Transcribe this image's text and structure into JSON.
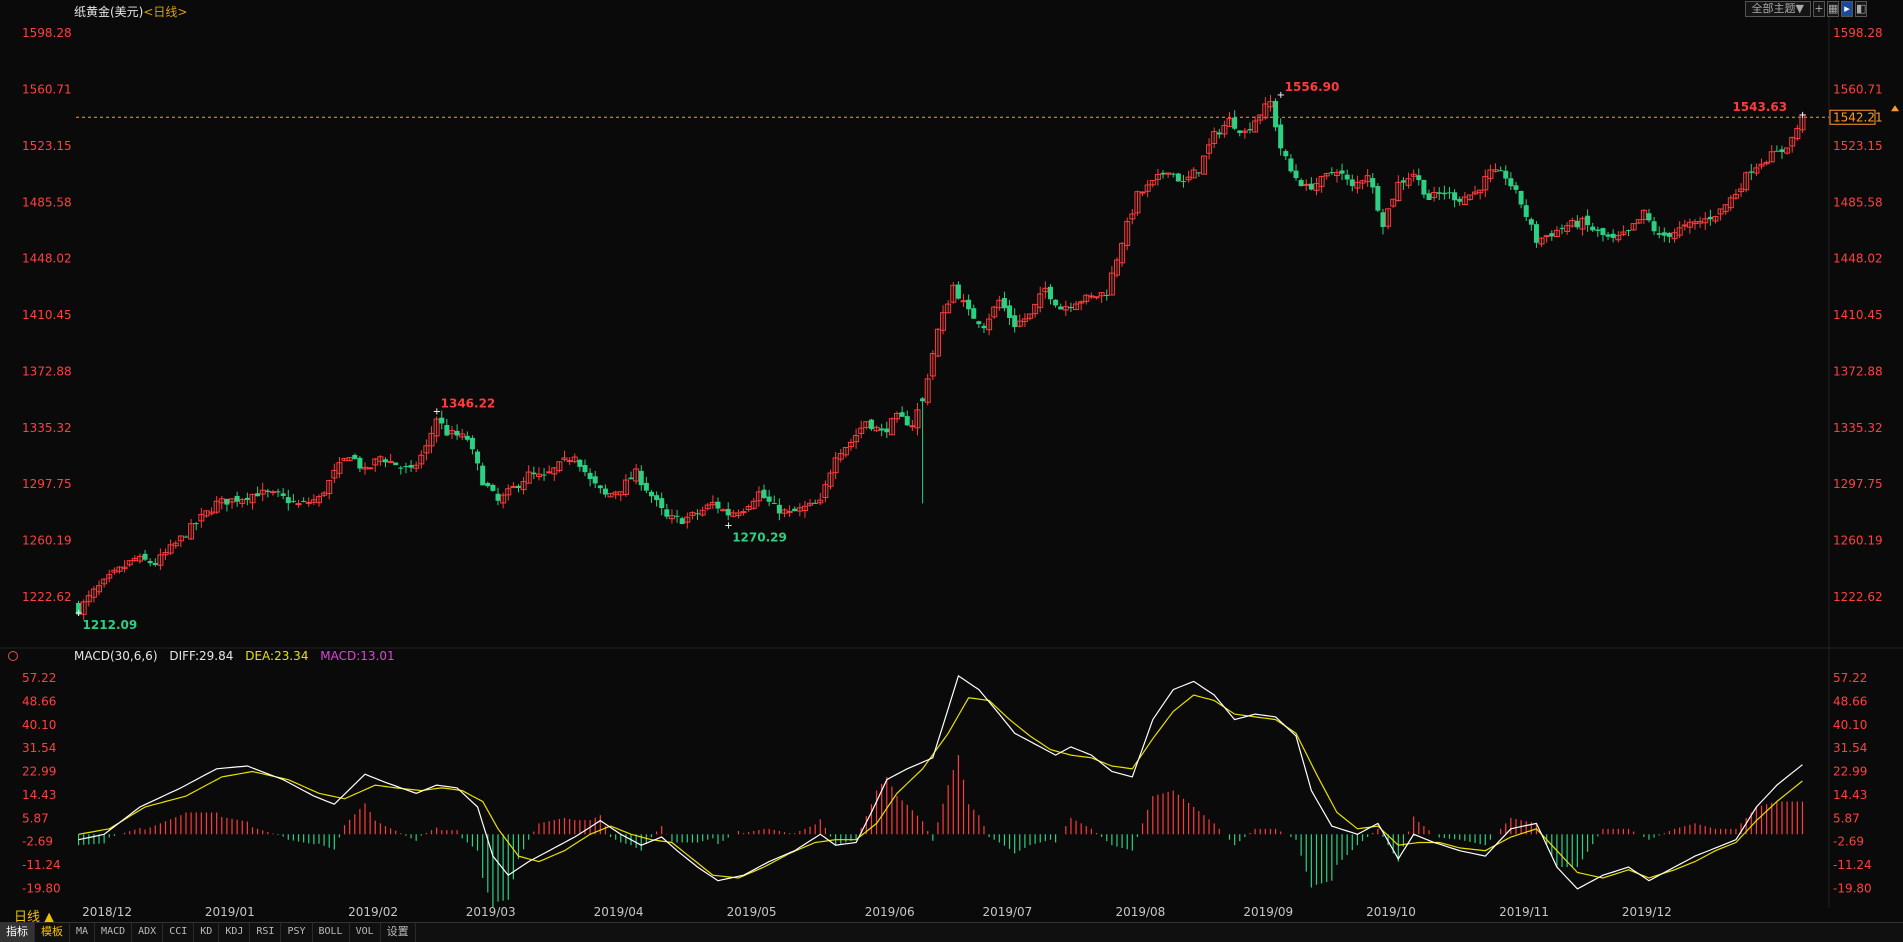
{
  "header": {
    "instrument": "纸黄金(美元)",
    "period": "<日线>",
    "theme_button": "全部主题▼"
  },
  "macd_header": {
    "name": "MACD(30,6,6)",
    "diff": "DIFF:29.84",
    "dea": "DEA:23.34",
    "macd": "MACD:13.01"
  },
  "period_label": "日线 ▲",
  "tabs": [
    "指标",
    "模板",
    "MA",
    "MACD",
    "ADX",
    "CCI",
    "KD",
    "KDJ",
    "RSI",
    "PSY",
    "BOLL",
    "VOL",
    "设置"
  ],
  "colors": {
    "up": "#ff3b3b",
    "down": "#2bd083",
    "diff_line": "#ffffff",
    "dea_line": "#e8e000",
    "axis_text": "#ff4040",
    "date_text": "#c8c8c8",
    "last_price": "#ff9a2a"
  },
  "chart_data": [
    {
      "type": "candlestick",
      "title": "纸黄金(美元)",
      "ylim": [
        1194,
        1607
      ],
      "y_ticks": [
        1598.28,
        1560.71,
        1523.15,
        1485.58,
        1448.02,
        1410.45,
        1372.88,
        1335.32,
        1297.75,
        1260.19,
        1222.62
      ],
      "x_ticks": [
        "2018/12",
        "2019/01",
        "2019/02",
        "2019/03",
        "2019/04",
        "2019/05",
        "2019/06",
        "2019/07",
        "2019/08",
        "2019/09",
        "2019/10",
        "2019/11",
        "2019/12"
      ],
      "x_tick_index": [
        5,
        29,
        57,
        80,
        105,
        131,
        158,
        181,
        207,
        232,
        256,
        282,
        306
      ],
      "annotations": [
        {
          "label": "1212.09",
          "index": 0,
          "value": 1212.09,
          "kind": "low"
        },
        {
          "label": "1346.22",
          "index": 70,
          "value": 1346.22,
          "kind": "high"
        },
        {
          "label": "1270.29",
          "index": 127,
          "value": 1270.29,
          "kind": "low"
        },
        {
          "label": "1556.90",
          "index": 235,
          "value": 1556.9,
          "kind": "high"
        },
        {
          "label": "1543.63",
          "index": 337,
          "value": 1543.63,
          "kind": "high"
        }
      ],
      "last_price": 1542.21,
      "last_price_label": "1542.21",
      "close_waypoints": [
        [
          0,
          1214
        ],
        [
          3,
          1226
        ],
        [
          7,
          1238
        ],
        [
          11,
          1248
        ],
        [
          15,
          1245
        ],
        [
          19,
          1258
        ],
        [
          23,
          1272
        ],
        [
          27,
          1285
        ],
        [
          31,
          1288
        ],
        [
          35,
          1292
        ],
        [
          39,
          1290
        ],
        [
          43,
          1284
        ],
        [
          47,
          1288
        ],
        [
          50,
          1305
        ],
        [
          53,
          1318
        ],
        [
          56,
          1306
        ],
        [
          59,
          1316
        ],
        [
          62,
          1311
        ],
        [
          65,
          1306
        ],
        [
          68,
          1322
        ],
        [
          70,
          1342
        ],
        [
          72,
          1332
        ],
        [
          76,
          1328
        ],
        [
          79,
          1300
        ],
        [
          82,
          1286
        ],
        [
          85,
          1295
        ],
        [
          88,
          1304
        ],
        [
          91,
          1302
        ],
        [
          94,
          1310
        ],
        [
          97,
          1318
        ],
        [
          100,
          1300
        ],
        [
          103,
          1290
        ],
        [
          106,
          1295
        ],
        [
          109,
          1305
        ],
        [
          112,
          1290
        ],
        [
          115,
          1275
        ],
        [
          118,
          1274
        ],
        [
          121,
          1278
        ],
        [
          124,
          1285
        ],
        [
          127,
          1278
        ],
        [
          130,
          1282
        ],
        [
          133,
          1292
        ],
        [
          136,
          1282
        ],
        [
          139,
          1278
        ],
        [
          142,
          1282
        ],
        [
          145,
          1285
        ],
        [
          148,
          1318
        ],
        [
          151,
          1326
        ],
        [
          154,
          1340
        ],
        [
          157,
          1332
        ],
        [
          160,
          1342
        ],
        [
          163,
          1338
        ],
        [
          165,
          1355
        ],
        [
          168,
          1400
        ],
        [
          171,
          1430
        ],
        [
          174,
          1412
        ],
        [
          177,
          1404
        ],
        [
          180,
          1420
        ],
        [
          183,
          1404
        ],
        [
          186,
          1410
        ],
        [
          189,
          1428
        ],
        [
          192,
          1415
        ],
        [
          195,
          1420
        ],
        [
          198,
          1422
        ],
        [
          201,
          1426
        ],
        [
          204,
          1460
        ],
        [
          207,
          1490
        ],
        [
          210,
          1498
        ],
        [
          213,
          1508
        ],
        [
          216,
          1498
        ],
        [
          219,
          1508
        ],
        [
          222,
          1530
        ],
        [
          225,
          1540
        ],
        [
          228,
          1532
        ],
        [
          231,
          1545
        ],
        [
          233,
          1552
        ],
        [
          235,
          1522
        ],
        [
          237,
          1506
        ],
        [
          240,
          1495
        ],
        [
          243,
          1500
        ],
        [
          246,
          1508
        ],
        [
          249,
          1495
        ],
        [
          252,
          1505
        ],
        [
          255,
          1472
        ],
        [
          258,
          1498
        ],
        [
          261,
          1505
        ],
        [
          264,
          1488
        ],
        [
          267,
          1492
        ],
        [
          270,
          1488
        ],
        [
          273,
          1492
        ],
        [
          276,
          1505
        ],
        [
          279,
          1503
        ],
        [
          282,
          1485
        ],
        [
          285,
          1460
        ],
        [
          288,
          1465
        ],
        [
          291,
          1470
        ],
        [
          294,
          1472
        ],
        [
          297,
          1465
        ],
        [
          300,
          1460
        ],
        [
          303,
          1465
        ],
        [
          306,
          1478
        ],
        [
          309,
          1462
        ],
        [
          312,
          1466
        ],
        [
          315,
          1470
        ],
        [
          318,
          1474
        ],
        [
          321,
          1480
        ],
        [
          324,
          1492
        ],
        [
          327,
          1508
        ],
        [
          330,
          1515
        ],
        [
          333,
          1520
        ],
        [
          335,
          1528
        ],
        [
          337,
          1542
        ]
      ]
    },
    {
      "type": "bar+line",
      "title": "MACD(30,6,6)",
      "ylim": [
        -27,
        62
      ],
      "y_ticks": [
        57.22,
        48.66,
        40.1,
        31.54,
        22.99,
        14.43,
        5.87,
        -2.69,
        -11.24,
        -19.8
      ],
      "series": [
        {
          "name": "DIFF",
          "waypoints": [
            [
              0,
              -2
            ],
            [
              5,
              0
            ],
            [
              12,
              10
            ],
            [
              20,
              17
            ],
            [
              27,
              24
            ],
            [
              33,
              25
            ],
            [
              40,
              20
            ],
            [
              46,
              14
            ],
            [
              50,
              11
            ],
            [
              56,
              22
            ],
            [
              60,
              19
            ],
            [
              66,
              15
            ],
            [
              70,
              18
            ],
            [
              74,
              17
            ],
            [
              78,
              10
            ],
            [
              81,
              -8
            ],
            [
              84,
              -15
            ],
            [
              88,
              -10
            ],
            [
              92,
              -6
            ],
            [
              97,
              -1
            ],
            [
              102,
              5
            ],
            [
              106,
              0
            ],
            [
              110,
              -4
            ],
            [
              114,
              -1
            ],
            [
              117,
              -6
            ],
            [
              121,
              -12
            ],
            [
              125,
              -17
            ],
            [
              130,
              -15
            ],
            [
              135,
              -10
            ],
            [
              140,
              -6
            ],
            [
              145,
              0
            ],
            [
              148,
              -4
            ],
            [
              152,
              -3
            ],
            [
              155,
              8
            ],
            [
              158,
              20
            ],
            [
              162,
              24
            ],
            [
              167,
              28
            ],
            [
              172,
              58
            ],
            [
              176,
              53
            ],
            [
              180,
              44
            ],
            [
              183,
              37
            ],
            [
              187,
              33
            ],
            [
              191,
              29
            ],
            [
              194,
              32
            ],
            [
              198,
              29
            ],
            [
              202,
              23
            ],
            [
              206,
              21
            ],
            [
              210,
              42
            ],
            [
              214,
              53
            ],
            [
              218,
              56
            ],
            [
              222,
              51
            ],
            [
              226,
              42
            ],
            [
              230,
              44
            ],
            [
              234,
              43
            ],
            [
              238,
              36
            ],
            [
              241,
              16
            ],
            [
              245,
              3
            ],
            [
              250,
              0
            ],
            [
              254,
              4
            ],
            [
              258,
              -9
            ],
            [
              261,
              0
            ],
            [
              265,
              -3
            ],
            [
              270,
              -6
            ],
            [
              275,
              -8
            ],
            [
              280,
              2
            ],
            [
              285,
              4
            ],
            [
              289,
              -12
            ],
            [
              293,
              -20
            ],
            [
              298,
              -15
            ],
            [
              303,
              -12
            ],
            [
              307,
              -17
            ],
            [
              312,
              -12
            ],
            [
              316,
              -8
            ],
            [
              320,
              -5
            ],
            [
              324,
              -2
            ],
            [
              328,
              10
            ],
            [
              332,
              18
            ],
            [
              336,
              24
            ],
            [
              340,
              30
            ]
          ]
        },
        {
          "name": "DEA",
          "waypoints": [
            [
              0,
              0
            ],
            [
              6,
              2
            ],
            [
              13,
              10
            ],
            [
              21,
              14
            ],
            [
              28,
              21
            ],
            [
              34,
              23
            ],
            [
              41,
              20
            ],
            [
              47,
              15
            ],
            [
              52,
              13
            ],
            [
              58,
              18
            ],
            [
              62,
              17
            ],
            [
              67,
              16
            ],
            [
              71,
              17
            ],
            [
              75,
              16
            ],
            [
              79,
              12
            ],
            [
              82,
              2
            ],
            [
              86,
              -8
            ],
            [
              90,
              -10
            ],
            [
              95,
              -6
            ],
            [
              100,
              0
            ],
            [
              104,
              3
            ],
            [
              108,
              0
            ],
            [
              112,
              -2
            ],
            [
              116,
              -3
            ],
            [
              120,
              -9
            ],
            [
              124,
              -15
            ],
            [
              129,
              -16
            ],
            [
              134,
              -12
            ],
            [
              139,
              -7
            ],
            [
              144,
              -3
            ],
            [
              148,
              -2
            ],
            [
              152,
              -2
            ],
            [
              156,
              4
            ],
            [
              160,
              15
            ],
            [
              165,
              24
            ],
            [
              170,
              37
            ],
            [
              174,
              50
            ],
            [
              178,
              49
            ],
            [
              182,
              42
            ],
            [
              186,
              36
            ],
            [
              190,
              31
            ],
            [
              194,
              29
            ],
            [
              198,
              28
            ],
            [
              202,
              25
            ],
            [
              206,
              24
            ],
            [
              210,
              35
            ],
            [
              214,
              45
            ],
            [
              218,
              51
            ],
            [
              222,
              49
            ],
            [
              226,
              44
            ],
            [
              230,
              43
            ],
            [
              234,
              42
            ],
            [
              238,
              37
            ],
            [
              242,
              22
            ],
            [
              246,
              8
            ],
            [
              250,
              2
            ],
            [
              254,
              3
            ],
            [
              258,
              -4
            ],
            [
              262,
              -3
            ],
            [
              266,
              -3
            ],
            [
              270,
              -5
            ],
            [
              275,
              -6
            ],
            [
              280,
              -1
            ],
            [
              285,
              2
            ],
            [
              289,
              -6
            ],
            [
              293,
              -14
            ],
            [
              298,
              -16
            ],
            [
              303,
              -13
            ],
            [
              307,
              -16
            ],
            [
              312,
              -13
            ],
            [
              316,
              -10
            ],
            [
              320,
              -6
            ],
            [
              324,
              -3
            ],
            [
              328,
              5
            ],
            [
              332,
              12
            ],
            [
              336,
              18
            ],
            [
              340,
              24
            ]
          ]
        }
      ]
    }
  ]
}
